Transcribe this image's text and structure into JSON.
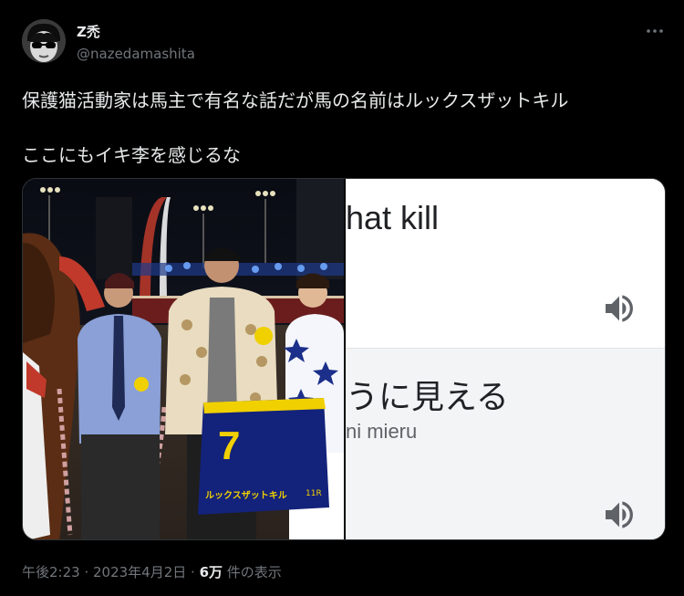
{
  "author": {
    "display_name": "Z禿",
    "handle": "@nazedamashita",
    "avatar_icon": "avatar-sunglasses-icon"
  },
  "more_icon": "more-horizontal-icon",
  "tweet": {
    "line1": "保護猫活動家は馬主で有名な話だが馬の名前はルックスザットキル",
    "line2": "ここにもイキ李を感じるな"
  },
  "media": {
    "photo": {
      "saddle_number": "7",
      "horse_name": "ルックスザットキル",
      "race_label": "11R"
    },
    "translation": {
      "english_fragment": "hat kill",
      "japanese_fragment": "うに見える",
      "romaji_fragment": "ni mieru",
      "speaker_icon": "speaker-icon"
    }
  },
  "footer": {
    "time": "午後2:23",
    "sep1": " · ",
    "date": "2023年4月2日",
    "sep2": " · ",
    "views_count": "6万",
    "views_label": " 件の表示"
  },
  "colors": {
    "background": "#000000",
    "text_primary": "#e7e9ea",
    "text_secondary": "#71767b",
    "border": "#2f3336",
    "translate_bg": "#ffffff",
    "translate_bottom_bg": "#f3f4f6"
  }
}
